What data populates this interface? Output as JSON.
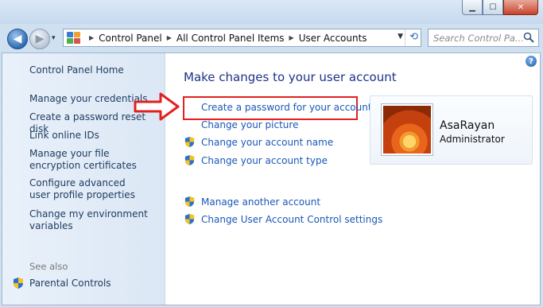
{
  "window": {
    "minimize_glyph": "▁",
    "maximize_glyph": "☐",
    "close_glyph": "✕"
  },
  "nav": {
    "back_glyph": "◀",
    "forward_glyph": "▶",
    "recent_glyph": "▾"
  },
  "address": {
    "crumbs": [
      "Control Panel",
      "All Control Panel Items",
      "User Accounts"
    ],
    "separator": "▶",
    "dropdown_glyph": "▼",
    "refresh_glyph": "⟲"
  },
  "search": {
    "placeholder": "Search Control Pa..."
  },
  "sidebar": {
    "items": [
      "Control Panel Home",
      "Manage your credentials",
      "Create a password reset disk",
      "Link online IDs",
      "Manage your file encryption certificates",
      "Configure advanced user profile properties",
      "Change my environment variables"
    ],
    "see_also_label": "See also",
    "see_also_items": [
      "Parental Controls"
    ]
  },
  "main": {
    "heading": "Make changes to your user account",
    "tasks": [
      "Create a password for your account",
      "Change your picture",
      "Change your account name",
      "Change your account type"
    ],
    "other_tasks": [
      "Manage another account",
      "Change User Account Control settings"
    ]
  },
  "user": {
    "name": "AsaRayan",
    "role": "Administrator"
  },
  "help_glyph": "?",
  "colors": {
    "link": "#1a57b8",
    "heading": "#1e3287",
    "highlight": "#e32020"
  }
}
